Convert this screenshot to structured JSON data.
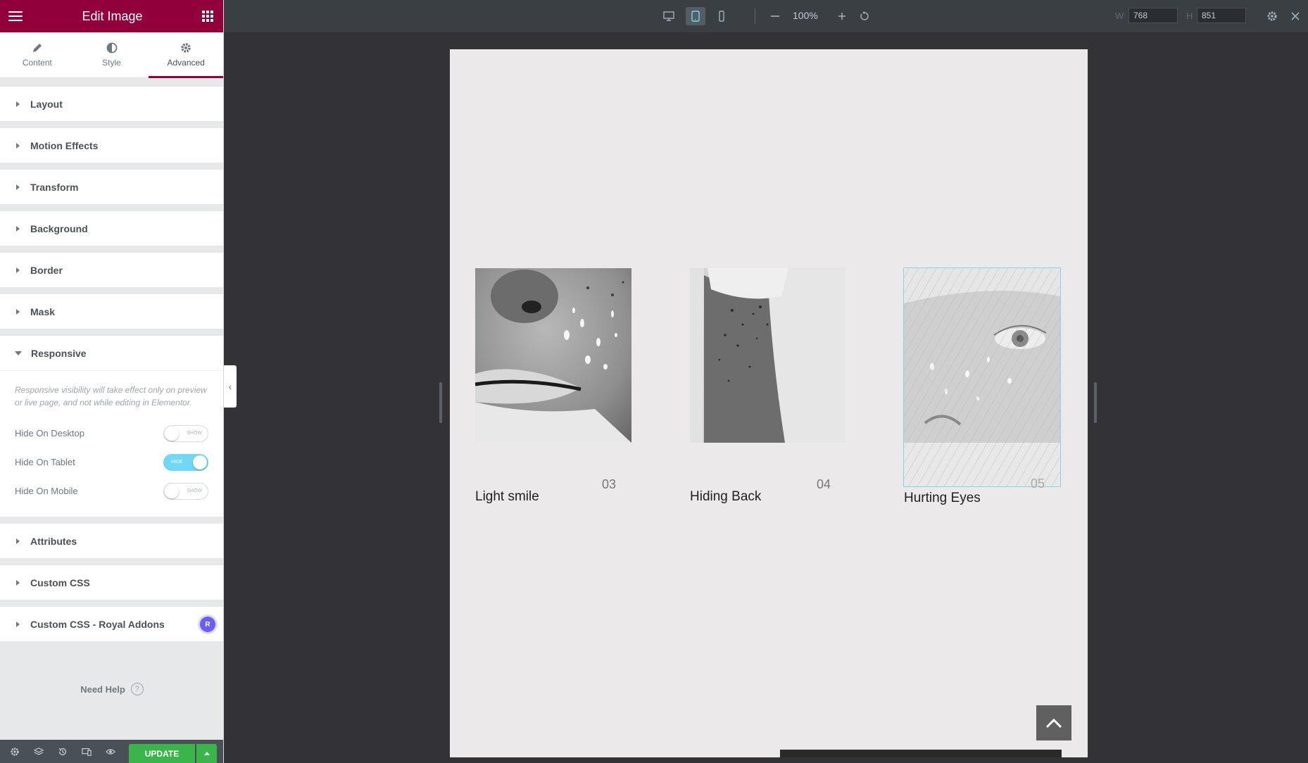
{
  "sidebar": {
    "header_title": "Edit Image",
    "tabs": [
      {
        "label": "Content"
      },
      {
        "label": "Style"
      },
      {
        "label": "Advanced"
      }
    ],
    "sections": [
      {
        "label": "Layout"
      },
      {
        "label": "Motion Effects"
      },
      {
        "label": "Transform"
      },
      {
        "label": "Background"
      },
      {
        "label": "Border"
      },
      {
        "label": "Mask"
      },
      {
        "label": "Responsive"
      },
      {
        "label": "Attributes"
      },
      {
        "label": "Custom CSS"
      },
      {
        "label": "Custom CSS - Royal Addons",
        "badge": "R"
      }
    ],
    "responsive": {
      "note": "Responsive visibility will take effect only on preview or live page, and not while editing in Elementor.",
      "controls": [
        {
          "label": "Hide On Desktop",
          "state": "SHOW",
          "on": false
        },
        {
          "label": "Hide On Tablet",
          "state": "HIDE",
          "on": true
        },
        {
          "label": "Hide On Mobile",
          "state": "SHOW",
          "on": false
        }
      ]
    },
    "need_help": "Need Help",
    "need_help_icon": "?",
    "update_label": "UPDATE"
  },
  "topbar": {
    "zoom": "100%",
    "width_label": "W",
    "width_value": "768",
    "height_label": "H",
    "height_value": "851"
  },
  "canvas": {
    "cards": [
      {
        "title": "Light smile",
        "number": "03"
      },
      {
        "title": "Hiding Back",
        "number": "04"
      },
      {
        "title": "Hurting Eyes",
        "number": "05"
      }
    ]
  },
  "colors": {
    "brand": "#92003b",
    "toggle_on": "#71d7f7",
    "update": "#39b54a",
    "badge": "#6a5ef7"
  }
}
